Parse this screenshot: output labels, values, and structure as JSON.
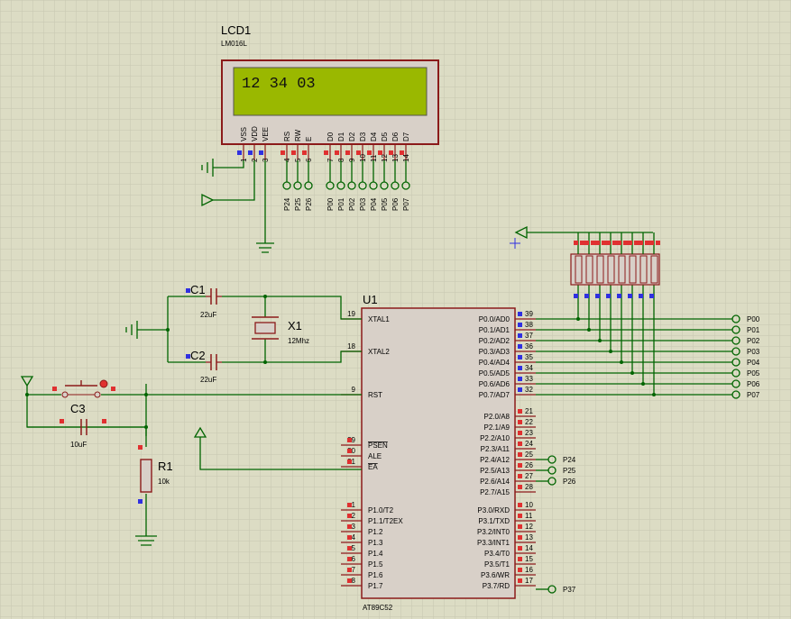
{
  "colors": {
    "background": "#dcdcc4",
    "grid": "#c6c6b0",
    "wire": "#006400",
    "body_outline": "#8b1a1a",
    "chip_fill": "#d8d0c8",
    "lcd_screen": "#9ab800",
    "pin_red": "#e03030",
    "pin_blue": "#3030e0"
  },
  "lcd": {
    "ref": "LCD1",
    "model": "LM016L",
    "display_text": "12 34 03",
    "pin_names": [
      "VSS",
      "VDD",
      "VEE",
      "RS",
      "RW",
      "E",
      "D0",
      "D1",
      "D2",
      "D3",
      "D4",
      "D5",
      "D6",
      "D7"
    ],
    "pin_numbers": [
      "1",
      "2",
      "3",
      "4",
      "5",
      "6",
      "7",
      "8",
      "9",
      "10",
      "11",
      "12",
      "13",
      "14"
    ],
    "ctrl_terminals": [
      "P24",
      "P25",
      "P26"
    ],
    "data_terminals": [
      "P00",
      "P01",
      "P02",
      "P03",
      "P04",
      "P05",
      "P06",
      "P07"
    ]
  },
  "mcu": {
    "ref": "U1",
    "model": "AT89C52",
    "left_pins": [
      {
        "num": "19",
        "name": "XTAL1"
      },
      {
        "num": "18",
        "name": "XTAL2"
      },
      {
        "num": "9",
        "name": "RST"
      },
      {
        "num": "29",
        "name": "PSEN"
      },
      {
        "num": "30",
        "name": "ALE"
      },
      {
        "num": "31",
        "name": "EA"
      },
      {
        "num": "1",
        "name": "P1.0/T2"
      },
      {
        "num": "2",
        "name": "P1.1/T2EX"
      },
      {
        "num": "3",
        "name": "P1.2"
      },
      {
        "num": "4",
        "name": "P1.3"
      },
      {
        "num": "5",
        "name": "P1.4"
      },
      {
        "num": "6",
        "name": "P1.5"
      },
      {
        "num": "7",
        "name": "P1.6"
      },
      {
        "num": "8",
        "name": "P1.7"
      }
    ],
    "right_pins": [
      {
        "num": "39",
        "name": "P0.0/AD0"
      },
      {
        "num": "38",
        "name": "P0.1/AD1"
      },
      {
        "num": "37",
        "name": "P0.2/AD2"
      },
      {
        "num": "36",
        "name": "P0.3/AD3"
      },
      {
        "num": "35",
        "name": "P0.4/AD4"
      },
      {
        "num": "34",
        "name": "P0.5/AD5"
      },
      {
        "num": "33",
        "name": "P0.6/AD6"
      },
      {
        "num": "32",
        "name": "P0.7/AD7"
      },
      {
        "num": "21",
        "name": "P2.0/A8"
      },
      {
        "num": "22",
        "name": "P2.1/A9"
      },
      {
        "num": "23",
        "name": "P2.2/A10"
      },
      {
        "num": "24",
        "name": "P2.3/A11"
      },
      {
        "num": "25",
        "name": "P2.4/A12"
      },
      {
        "num": "26",
        "name": "P2.5/A13"
      },
      {
        "num": "27",
        "name": "P2.6/A14"
      },
      {
        "num": "28",
        "name": "P2.7/A15"
      },
      {
        "num": "10",
        "name": "P3.0/RXD"
      },
      {
        "num": "11",
        "name": "P3.1/TXD"
      },
      {
        "num": "12",
        "name": "P3.2/INT0"
      },
      {
        "num": "13",
        "name": "P3.3/INT1"
      },
      {
        "num": "14",
        "name": "P3.4/T0"
      },
      {
        "num": "15",
        "name": "P3.5/T1"
      },
      {
        "num": "16",
        "name": "P3.6/WR"
      },
      {
        "num": "17",
        "name": "P3.7/RD"
      }
    ],
    "port0_terminals": [
      "P00",
      "P01",
      "P02",
      "P03",
      "P04",
      "P05",
      "P06",
      "P07"
    ],
    "port2_terminals": [
      "P24",
      "P25",
      "P26"
    ],
    "port3_terminal": "P37"
  },
  "components": {
    "c1": {
      "ref": "C1",
      "value": "22uF"
    },
    "c2": {
      "ref": "C2",
      "value": "22uF"
    },
    "c3": {
      "ref": "C3",
      "value": "10uF"
    },
    "x1": {
      "ref": "X1",
      "value": "12Mhz"
    },
    "r1": {
      "ref": "R1",
      "value": "10k"
    }
  }
}
